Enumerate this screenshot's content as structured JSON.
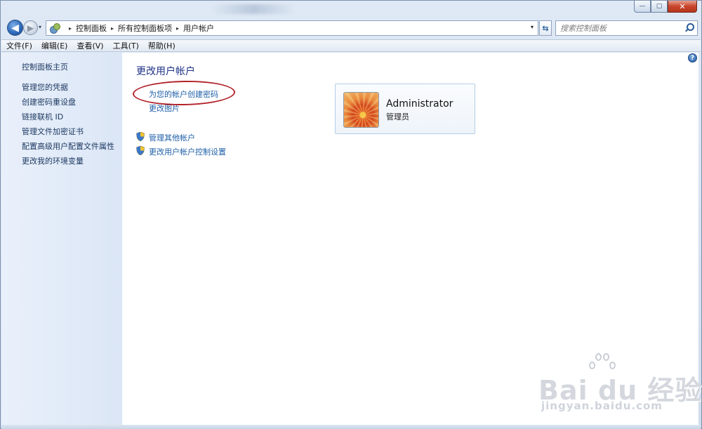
{
  "window": {
    "caption": {
      "minimize": "—",
      "maximize": "▢",
      "close": "✕"
    }
  },
  "navigation": {
    "back": "◀",
    "forward": "▶",
    "recent": "▾",
    "breadcrumbs": [
      "控制面板",
      "所有控制面板项",
      "用户帐户"
    ],
    "separator": "▸",
    "dropdown": "▾",
    "refresh": "⇆",
    "search_placeholder": "搜索控制面板"
  },
  "menu": {
    "items": [
      "文件(F)",
      "编辑(E)",
      "查看(V)",
      "工具(T)",
      "帮助(H)"
    ]
  },
  "sidebar": {
    "items": [
      "控制面板主页",
      "管理您的凭据",
      "创建密码重设盘",
      "链接联机 ID",
      "管理文件加密证书",
      "配置高级用户配置文件属性",
      "更改我的环境变量"
    ]
  },
  "main": {
    "help": "?",
    "title": "更改用户帐户",
    "links": [
      "为您的帐户创建密码",
      "更改图片"
    ],
    "admin_links": [
      "管理其他帐户",
      "更改用户帐户控制设置"
    ]
  },
  "account": {
    "name": "Administrator",
    "role": "管理员"
  },
  "watermark": {
    "brand": "Bai du 经验",
    "url": "jingyan.baidu.com"
  },
  "colors": {
    "link": "#1e5fa8",
    "title": "#1e3287",
    "annotation": "#b3232b"
  }
}
